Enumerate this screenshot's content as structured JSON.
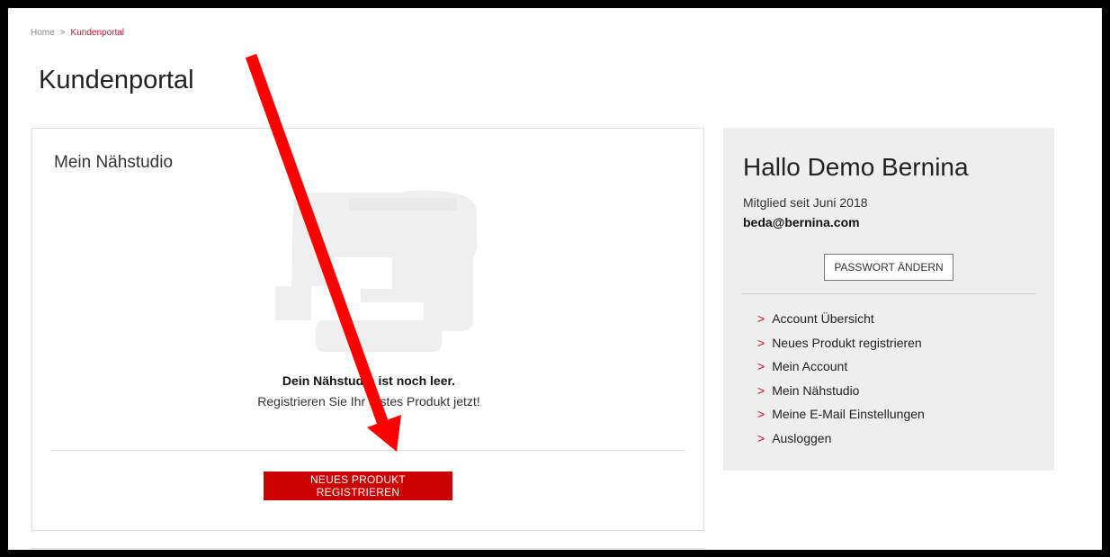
{
  "breadcrumb": {
    "home": "Home",
    "separator": ">",
    "current": "Kundenportal"
  },
  "page": {
    "title": "Kundenportal"
  },
  "studio": {
    "title": "Mein Nähstudio",
    "empty_title": "Dein Nähstudio ist noch leer.",
    "empty_subtitle": "Registrieren Sie Ihr erstes Produkt jetzt!",
    "button_label": "NEUES PRODUKT REGISTRIEREN",
    "illustration_icon": "sewing-machine-icon"
  },
  "account": {
    "greeting": "Hallo Demo Bernina",
    "member_since": "Mitglied seit Juni 2018",
    "email": "beda@bernina.com",
    "password_button": "PASSWORT ÄNDERN",
    "nav_chevron": ">",
    "nav": [
      "Account Übersicht",
      "Neues Produkt registrieren",
      "Mein Account",
      "Mein Nähstudio",
      "Meine E-Mail Einstellungen",
      "Ausloggen"
    ]
  },
  "colors": {
    "accent": "#c8102e",
    "button_red": "#cc0000",
    "annotation_arrow": "#ff0000",
    "panel_bg": "#eeeeee"
  }
}
